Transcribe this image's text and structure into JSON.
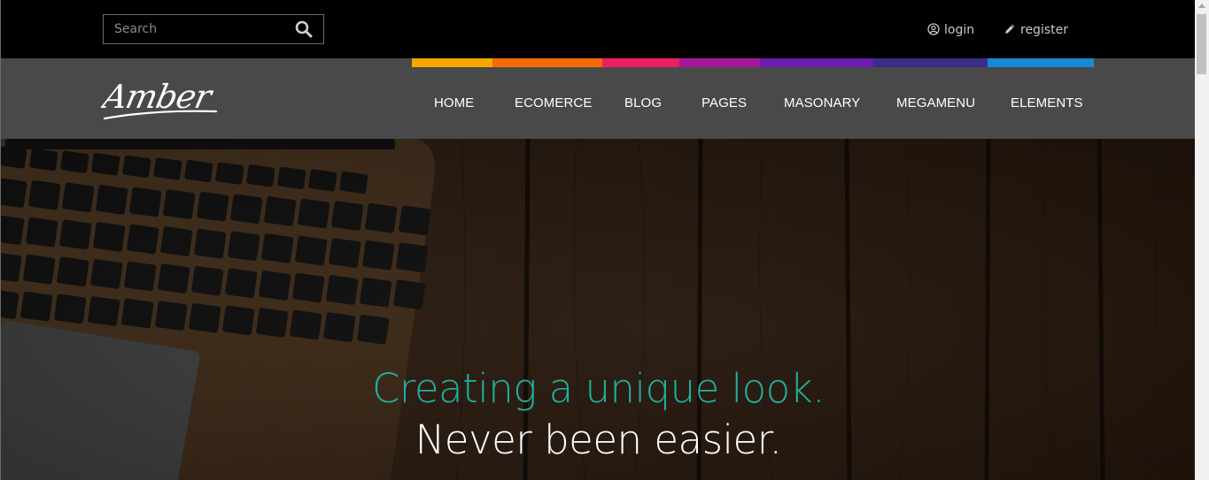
{
  "header": {
    "search": {
      "placeholder": "Search",
      "value": ""
    },
    "login_label": "login",
    "register_label": "register"
  },
  "brand": {
    "logo_text": "Amber"
  },
  "nav": {
    "items": [
      "HOME",
      "ECOMERCE",
      "BLOG",
      "PAGES",
      "MASONARY",
      "MEGAMENU",
      "ELEMENTS"
    ],
    "accent_colors": [
      "#f5a700",
      "#f46a06",
      "#e91e63",
      "#a4179a",
      "#6a1bb1",
      "#3c2c85",
      "#168ad6"
    ]
  },
  "hero": {
    "headline_accent": "Creating a unique look.",
    "headline_main": "Never been easier.",
    "accent_color": "#21b0a0"
  },
  "icons": {
    "search": "search-icon",
    "login": "user-circle-icon",
    "register": "pencil-icon"
  }
}
